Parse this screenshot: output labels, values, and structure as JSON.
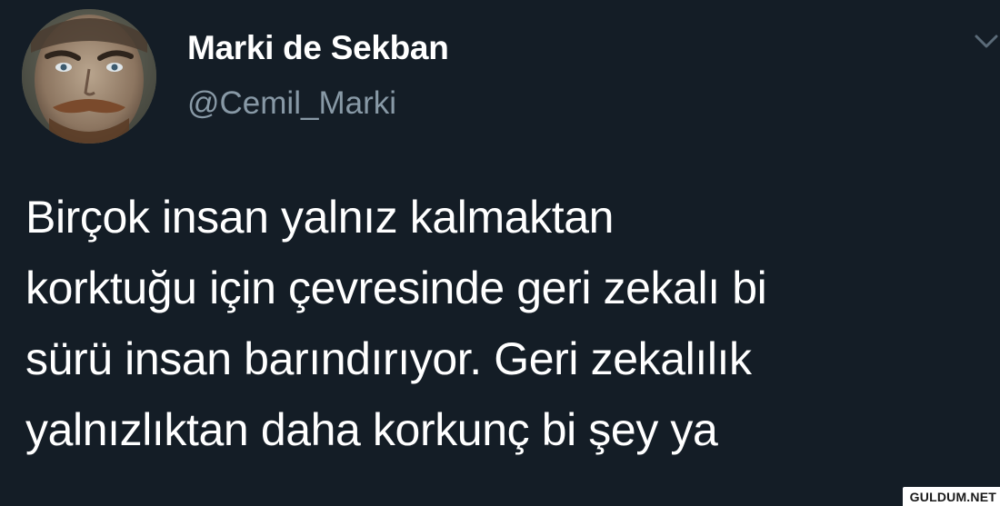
{
  "author": {
    "display_name": "Marki de Sekban",
    "handle": "@Cemil_Marki",
    "avatar_icon": "profile-photo"
  },
  "menu": {
    "icon": "chevron-down-icon"
  },
  "tweet": {
    "lines": [
      "Birçok insan yalnız kalmaktan",
      "korktuğu için çevresinde geri zekalı bi",
      "sürü insan barındırıyor. Geri zekalılık",
      "yalnızlıktan daha korkunç bi şey ya"
    ]
  },
  "watermark": "GULDUM.NET",
  "colors": {
    "background": "#141d26",
    "name": "#ffffff",
    "handle": "#8899a6",
    "text": "#ffffff"
  }
}
